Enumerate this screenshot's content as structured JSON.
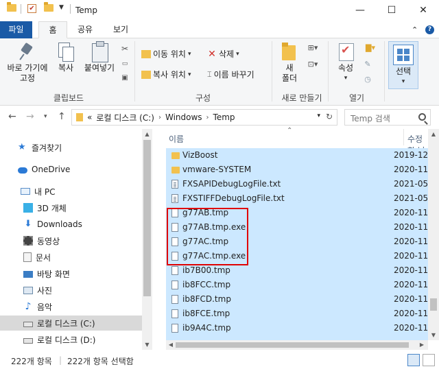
{
  "window": {
    "title": "Temp",
    "minimize": "—",
    "maximize": "☐",
    "close": "✕"
  },
  "tabs": {
    "file": "파일",
    "home": "홈",
    "share": "공유",
    "view": "보기"
  },
  "ribbon": {
    "clipboard": {
      "label": "클립보드",
      "pin": "바로 가기에 고정",
      "pin_line1": "바로 가기에",
      "pin_line2": "고정",
      "copy": "복사",
      "paste": "붙여넣기"
    },
    "organize": {
      "label": "구성",
      "move_to": "이동 위치",
      "copy_to": "복사 위치",
      "delete": "삭제",
      "rename": "이름 바꾸기"
    },
    "new": {
      "label": "새로 만들기",
      "new_folder_line1": "새",
      "new_folder_line2": "폴더"
    },
    "open": {
      "label": "열기",
      "properties": "속성"
    },
    "select": {
      "label": "선택"
    }
  },
  "address": {
    "crumbs": [
      "로컬 디스크 (C:)",
      "Windows",
      "Temp"
    ],
    "prefix": "«",
    "search_placeholder": "Temp 검색"
  },
  "sidebar": {
    "items": [
      {
        "label": "즐겨찾기",
        "icon": "star-icon"
      },
      {
        "label": "OneDrive",
        "icon": "cloud-icon"
      },
      {
        "label": "내 PC",
        "icon": "pc-icon"
      },
      {
        "label": "3D 개체",
        "icon": "cube-icon"
      },
      {
        "label": "Downloads",
        "icon": "download-icon"
      },
      {
        "label": "동영상",
        "icon": "film-icon"
      },
      {
        "label": "문서",
        "icon": "document-icon"
      },
      {
        "label": "바탕 화면",
        "icon": "desktop-icon"
      },
      {
        "label": "사진",
        "icon": "picture-icon"
      },
      {
        "label": "음악",
        "icon": "music-icon"
      },
      {
        "label": "로컬 디스크 (C:)",
        "icon": "drive-icon"
      },
      {
        "label": "로컬 디스크 (D:)",
        "icon": "drive-icon"
      }
    ]
  },
  "list": {
    "col_name": "이름",
    "col_modified": "수정한 날",
    "files": [
      {
        "name": "VizBoost",
        "date": "2019-12",
        "type": "folder"
      },
      {
        "name": "vmware-SYSTEM",
        "date": "2020-11",
        "type": "folder"
      },
      {
        "name": "FXSAPIDebugLogFile.txt",
        "date": "2021-05",
        "type": "txt"
      },
      {
        "name": "FXSTIFFDebugLogFile.txt",
        "date": "2021-05",
        "type": "txt"
      },
      {
        "name": "g77AB.tmp",
        "date": "2020-11",
        "type": "file"
      },
      {
        "name": "g77AB.tmp.exe",
        "date": "2020-11",
        "type": "file"
      },
      {
        "name": "g77AC.tmp",
        "date": "2020-11",
        "type": "file"
      },
      {
        "name": "g77AC.tmp.exe",
        "date": "2020-11",
        "type": "file"
      },
      {
        "name": "ib7B00.tmp",
        "date": "2020-11",
        "type": "file"
      },
      {
        "name": "ib8FCC.tmp",
        "date": "2020-11",
        "type": "file"
      },
      {
        "name": "ib8FCD.tmp",
        "date": "2020-11",
        "type": "file"
      },
      {
        "name": "ib8FCE.tmp",
        "date": "2020-11",
        "type": "file"
      },
      {
        "name": "ib9A4C.tmp",
        "date": "2020-11",
        "type": "file"
      }
    ]
  },
  "status": {
    "count": "222개 항목",
    "selected": "222개 항목 선택함"
  },
  "colors": {
    "accent": "#1a5aa6",
    "selection": "#cce8ff",
    "highlight_border": "#e00000"
  }
}
